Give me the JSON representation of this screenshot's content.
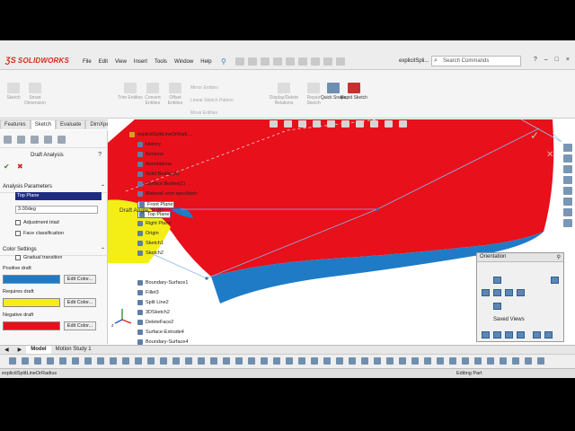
{
  "app": {
    "brand": "SOLIDWORKS",
    "menus": [
      "File",
      "Edit",
      "View",
      "Insert",
      "Tools",
      "Window",
      "Help"
    ],
    "doc_title": "explicitSpli...",
    "search_placeholder": "Search Commands"
  },
  "commands": [
    {
      "label": "Sketch",
      "active": false
    },
    {
      "label": "Smart Dimension",
      "active": false
    },
    {
      "label": "Trim Entities",
      "active": false
    },
    {
      "label": "Convert Entities",
      "active": false
    },
    {
      "label": "Offset Entities",
      "active": false
    },
    {
      "label": "Display/Delete Relations",
      "active": false
    },
    {
      "label": "Repair Sketch",
      "active": false
    },
    {
      "label": "Quick Snaps",
      "active": true
    },
    {
      "label": "Rapid Sketch",
      "active": true
    }
  ],
  "commands_small": [
    "Mirror Entities",
    "Linear Sketch Pattern",
    "Move Entities"
  ],
  "tabs": [
    "Features",
    "Sketch",
    "Evaluate",
    "DimXpert"
  ],
  "selected_tab": "Sketch",
  "panel": {
    "title": "Draft Analysis",
    "analysis_parameters": "Analysis Parameters",
    "direction_value": "Top Plane",
    "angle_value": "3.00deg",
    "adjustment_triad": "Adjustment triad",
    "face_classification": "Face classification",
    "color_settings": "Color Settings",
    "gradual_transition": "Gradual transition",
    "positive_draft": "Positive draft",
    "requires_draft": "Requires draft",
    "negative_draft": "Negative draft",
    "edit_color": "Edit Color...",
    "colors": {
      "positive": "#1f7bc6",
      "requires": "#f4ee16",
      "negative": "#e8101a"
    }
  },
  "tree": [
    "explicitSplitLineOrRadi...",
    "History",
    "Sensors",
    "Annotations",
    "Solid Bodies(1)",
    "Surface Bodies(1)",
    "Material <not specified>",
    "Front Plane",
    "Top Plane",
    "Right Plane",
    "Origin",
    "Sketch1",
    "Sketch2",
    "Boundary-Surface1",
    "Fillet3",
    "Split Line2",
    "3DSketch2",
    "DeleteFace2",
    "Surface-Extrude4",
    "Boundary-Surface4"
  ],
  "highlighted_tree_items": [
    "Front Plane",
    "Top Plane"
  ],
  "draft_label": "Draft Angle: 0.30",
  "orientation": {
    "title": "Orientation",
    "saved_views": "Saved Views"
  },
  "bottom_tabs": [
    "Model",
    "Motion Study 1"
  ],
  "status": {
    "file": "explicitSplitLineOrRadius",
    "mode": "Editing Part"
  }
}
